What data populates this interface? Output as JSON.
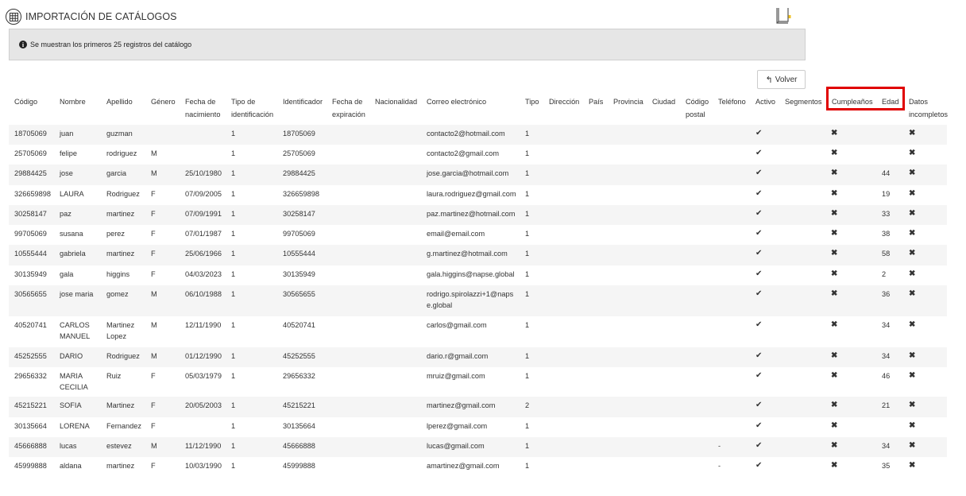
{
  "page": {
    "title": "IMPORTACIÓN DE CATÁLOGOS",
    "info_text": "Se muestran los primeros 25 registros del catálogo",
    "volver_label": "Volver"
  },
  "columns": [
    "Código",
    "Nombre",
    "Apellido",
    "Género",
    "Fecha de nacimiento",
    "Tipo de identificación",
    "Identificador",
    "Fecha de expiración",
    "Nacionalidad",
    "Correo electrónico",
    "Tipo",
    "Dirección",
    "País",
    "Provincia",
    "Ciudad",
    "Código postal",
    "Teléfono",
    "Activo",
    "Segmentos",
    "Cumpleaños",
    "Edad",
    "Datos incompletos"
  ],
  "rows": [
    {
      "codigo": "18705069",
      "nombre": "juan",
      "apellido": "guzman",
      "genero": "",
      "fecha": "",
      "tipoid": "1",
      "identificador": "18705069",
      "correo": "contacto2@hotmail.com",
      "tipo": "1",
      "telefono": "",
      "edad": ""
    },
    {
      "codigo": "25705069",
      "nombre": "felipe",
      "apellido": "rodriguez",
      "genero": "M",
      "fecha": "",
      "tipoid": "1",
      "identificador": "25705069",
      "correo": "contacto2@gmail.com",
      "tipo": "1",
      "telefono": "",
      "edad": ""
    },
    {
      "codigo": "29884425",
      "nombre": "jose",
      "apellido": "garcia",
      "genero": "M",
      "fecha": "25/10/1980",
      "tipoid": "1",
      "identificador": "29884425",
      "correo": "jose.garcia@hotmail.com",
      "tipo": "1",
      "telefono": "",
      "edad": "44"
    },
    {
      "codigo": "326659898",
      "nombre": "LAURA",
      "apellido": "Rodriguez",
      "genero": "F",
      "fecha": "07/09/2005",
      "tipoid": "1",
      "identificador": "326659898",
      "correo": "laura.rodriguez@gmail.com",
      "tipo": "1",
      "telefono": "",
      "edad": "19"
    },
    {
      "codigo": "30258147",
      "nombre": "paz",
      "apellido": "martinez",
      "genero": "F",
      "fecha": "07/09/1991",
      "tipoid": "1",
      "identificador": "30258147",
      "correo": "paz.martinez@hotmail.com",
      "tipo": "1",
      "telefono": "",
      "edad": "33"
    },
    {
      "codigo": "99705069",
      "nombre": "susana",
      "apellido": "perez",
      "genero": "F",
      "fecha": "07/01/1987",
      "tipoid": "1",
      "identificador": "99705069",
      "correo": "email@email.com",
      "tipo": "1",
      "telefono": "",
      "edad": "38"
    },
    {
      "codigo": "10555444",
      "nombre": "gabriela",
      "apellido": "martinez",
      "genero": "F",
      "fecha": "25/06/1966",
      "tipoid": "1",
      "identificador": "10555444",
      "correo": "g.martinez@hotmail.com",
      "tipo": "1",
      "telefono": "",
      "edad": "58"
    },
    {
      "codigo": "30135949",
      "nombre": "gala",
      "apellido": "higgins",
      "genero": "F",
      "fecha": "04/03/2023",
      "tipoid": "1",
      "identificador": "30135949",
      "correo": "gala.higgins@napse.global",
      "tipo": "1",
      "telefono": "",
      "edad": "2"
    },
    {
      "codigo": "30565655",
      "nombre": "jose maria",
      "apellido": "gomez",
      "genero": "M",
      "fecha": "06/10/1988",
      "tipoid": "1",
      "identificador": "30565655",
      "correo": "rodrigo.spirolazzi+1@napse.global",
      "tipo": "1",
      "telefono": "",
      "edad": "36"
    },
    {
      "codigo": "40520741",
      "nombre": "CARLOS MANUEL",
      "apellido": "Martinez Lopez",
      "genero": "M",
      "fecha": "12/11/1990",
      "tipoid": "1",
      "identificador": "40520741",
      "correo": "carlos@gmail.com",
      "tipo": "1",
      "telefono": "",
      "edad": "34"
    },
    {
      "codigo": "45252555",
      "nombre": "DARIO",
      "apellido": "Rodriguez",
      "genero": "M",
      "fecha": "01/12/1990",
      "tipoid": "1",
      "identificador": "45252555",
      "correo": "dario.r@gmail.com",
      "tipo": "1",
      "telefono": "",
      "edad": "34"
    },
    {
      "codigo": "29656332",
      "nombre": "MARIA CECILIA",
      "apellido": "Ruiz",
      "genero": "F",
      "fecha": "05/03/1979",
      "tipoid": "1",
      "identificador": "29656332",
      "correo": "mruiz@gmail.com",
      "tipo": "1",
      "telefono": "",
      "edad": "46"
    },
    {
      "codigo": "45215221",
      "nombre": "SOFIA",
      "apellido": "Martinez",
      "genero": "F",
      "fecha": "20/05/2003",
      "tipoid": "1",
      "identificador": "45215221",
      "correo": "martinez@gmail.com",
      "tipo": "2",
      "telefono": "",
      "edad": "21"
    },
    {
      "codigo": "30135664",
      "nombre": "LORENA",
      "apellido": "Fernandez",
      "genero": "F",
      "fecha": "",
      "tipoid": "1",
      "identificador": "30135664",
      "correo": "lperez@gmail.com",
      "tipo": "1",
      "telefono": "",
      "edad": ""
    },
    {
      "codigo": "45666888",
      "nombre": "lucas",
      "apellido": "estevez",
      "genero": "M",
      "fecha": "11/12/1990",
      "tipoid": "1",
      "identificador": "45666888",
      "correo": "lucas@gmail.com",
      "tipo": "1",
      "telefono": "-",
      "edad": "34"
    },
    {
      "codigo": "45999888",
      "nombre": "aldana",
      "apellido": "martinez",
      "genero": "F",
      "fecha": "10/03/1990",
      "tipoid": "1",
      "identificador": "45999888",
      "correo": "amartinez@gmail.com",
      "tipo": "1",
      "telefono": "-",
      "edad": "35"
    }
  ],
  "symbols": {
    "check": "✔",
    "cross": "✖"
  },
  "icons": {
    "title_icon": "table-grid-icon",
    "book_icon": "book-icon",
    "info_icon": "info-circle-icon",
    "back_icon": "reply-arrow-icon"
  },
  "colors": {
    "highlight": "#e00000",
    "info_bg": "#e6e6e6",
    "stripe": "#f5f5f5",
    "book_accent": "#f0c020"
  }
}
